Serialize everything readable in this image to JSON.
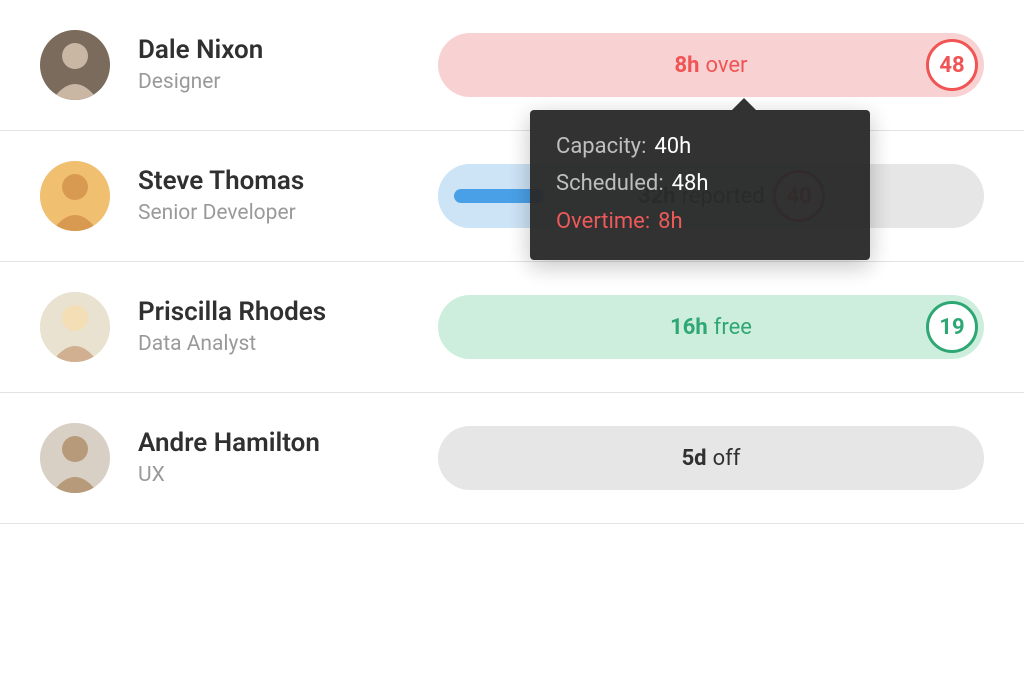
{
  "rows": [
    {
      "name": "Dale Nixon",
      "role": "Designer",
      "avatar_bg": "#7a6b5c",
      "status": "over",
      "bar_value": "8h",
      "bar_suffix": "over",
      "badge": "48"
    },
    {
      "name": "Steve Thomas",
      "role": "Senior Developer",
      "avatar_bg": "#f0c070",
      "status": "reported",
      "bar_value": "32h",
      "bar_suffix": "reported",
      "badge": "40"
    },
    {
      "name": "Priscilla Rhodes",
      "role": "Data Analyst",
      "avatar_bg": "#e9e2d0",
      "status": "free",
      "bar_value": "16h",
      "bar_suffix": "free",
      "badge": "19"
    },
    {
      "name": "Andre Hamilton",
      "role": "UX",
      "avatar_bg": "#d8d0c5",
      "status": "off",
      "bar_value": "5d",
      "bar_suffix": "off",
      "badge": ""
    }
  ],
  "tooltip": {
    "capacity_label": "Capacity:",
    "capacity_value": "40h",
    "scheduled_label": "Scheduled:",
    "scheduled_value": "48h",
    "overtime_label": "Overtime:",
    "overtime_value": "8h"
  },
  "colors": {
    "red": "#f05454",
    "green": "#2fa774",
    "blue": "#4aa0e6"
  }
}
